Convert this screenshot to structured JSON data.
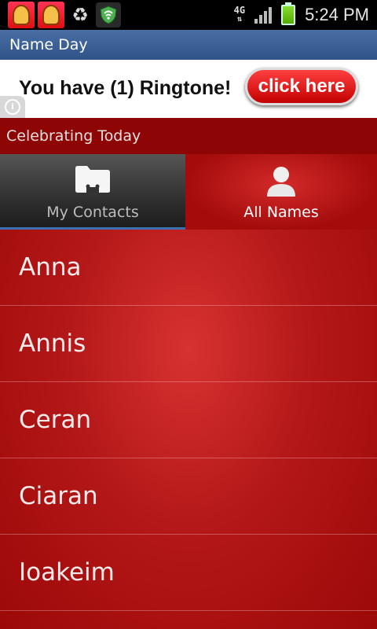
{
  "status_bar": {
    "network": "4G",
    "time": "5:24 PM"
  },
  "app": {
    "title": "Name Day"
  },
  "ad": {
    "text": "You have (1) Ringtone!",
    "button_label": "click here",
    "info_glyph": "i"
  },
  "section": {
    "title": "Celebrating Today"
  },
  "tabs": [
    {
      "label": "My Contacts",
      "icon": "folder-icon",
      "selected": false
    },
    {
      "label": "All Names",
      "icon": "person-icon",
      "selected": true
    }
  ],
  "names": [
    "Anna",
    "Annis",
    "Ceran",
    "Ciaran",
    "Ioakeim"
  ],
  "colors": {
    "title_bar": "#2f5387",
    "list_background": "#b41818",
    "tab_indicator": "#3d6fb3",
    "ad_button": "#e01010"
  }
}
